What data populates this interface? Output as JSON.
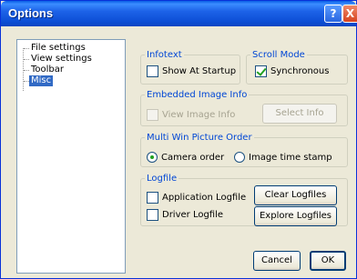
{
  "window": {
    "title": "Options",
    "help_glyph": "?",
    "close_glyph": "X"
  },
  "tree": {
    "items": [
      {
        "label": "File settings",
        "selected": false
      },
      {
        "label": "View settings",
        "selected": false
      },
      {
        "label": "Toolbar",
        "selected": false
      },
      {
        "label": "Misc",
        "selected": true
      }
    ]
  },
  "infotext": {
    "legend": "Infotext",
    "show_at_startup": {
      "label": "Show At Startup",
      "checked": false
    }
  },
  "scroll_mode": {
    "legend": "Scroll Mode",
    "synchronous": {
      "label": "Synchronous",
      "checked": true
    }
  },
  "embedded_image_info": {
    "legend": "Embedded Image Info",
    "view_image_info": {
      "label": "View Image Info",
      "checked": false,
      "enabled": false
    },
    "select_info_button": "Select Info"
  },
  "multi_win_order": {
    "legend": "Multi Win Picture Order",
    "options": [
      {
        "label": "Camera order",
        "selected": true
      },
      {
        "label": "Image time stamp",
        "selected": false
      }
    ]
  },
  "logfile": {
    "legend": "Logfile",
    "application_logfile": {
      "label": "Application Logfile",
      "checked": false
    },
    "driver_logfile": {
      "label": "Driver Logfile",
      "checked": false
    },
    "clear_button": "Clear Logfiles",
    "explore_button": "Explore Logfiles"
  },
  "footer": {
    "cancel_button": "Cancel",
    "ok_button": "OK"
  },
  "colors": {
    "title_bar": "#0d4fd6",
    "group_legend": "#0046d5",
    "selection": "#316ac5",
    "check_mark": "#21a121"
  }
}
